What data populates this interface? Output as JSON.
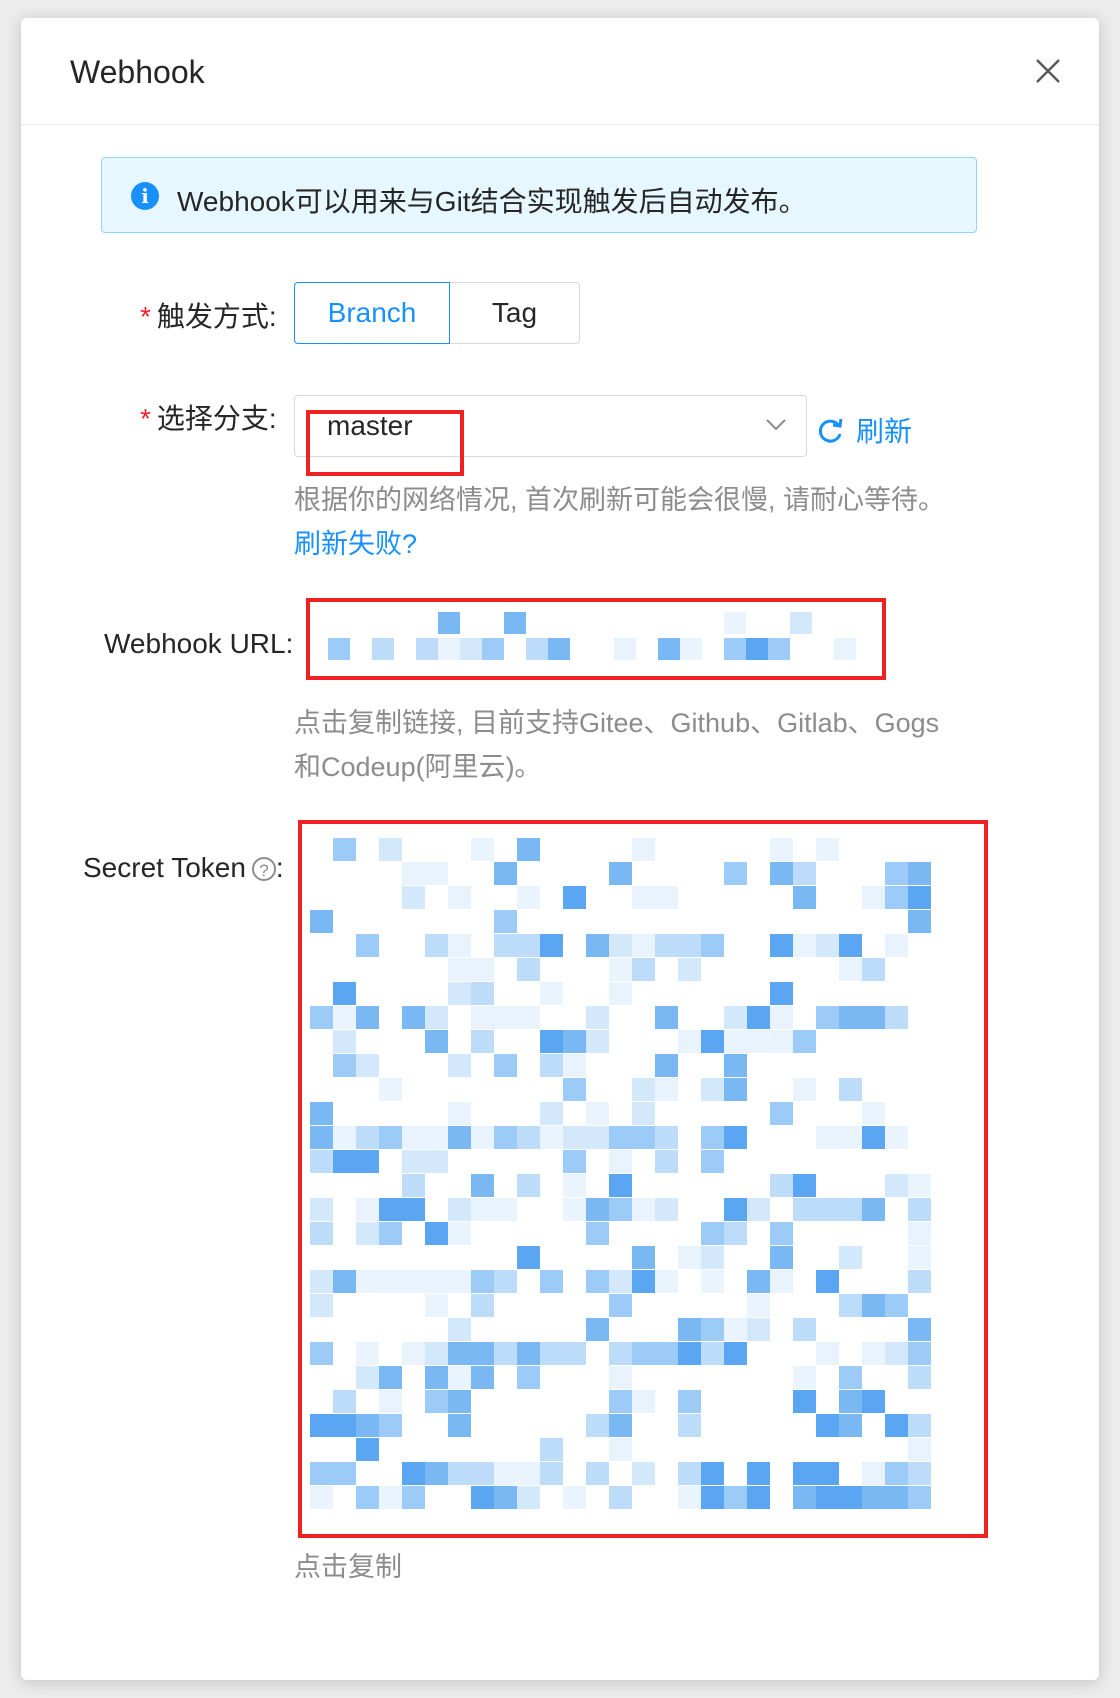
{
  "modal": {
    "title": "Webhook",
    "close_icon": "close-icon"
  },
  "alert": {
    "icon": "info-circle-icon",
    "text": "Webhook可以用来与Git结合实现触发后自动发布。"
  },
  "trigger": {
    "label": "触发方式:",
    "options": [
      "Branch",
      "Tag"
    ],
    "selected": "Branch"
  },
  "branch": {
    "label": "选择分支:",
    "value": "master",
    "refresh_label": "刷新",
    "refresh_icon": "refresh-icon",
    "help_text": "根据你的网络情况, 首次刷新可能会很慢, 请耐心等待。",
    "help_link": "刷新失败?"
  },
  "webhook_url": {
    "label": "Webhook URL:",
    "help_text": "点击复制链接, 目前支持Gitee、Github、Gitlab、Gogs和Codeup(阿里云)。"
  },
  "secret_token": {
    "label": "Secret Token",
    "help_icon": "question-circle-icon",
    "colon": ":",
    "copy_hint": "点击复制"
  },
  "colors": {
    "primary": "#1890ff",
    "required": "#f5222d",
    "annotation_red": "#ee2222",
    "alert_bg": "#e6f7ff"
  }
}
